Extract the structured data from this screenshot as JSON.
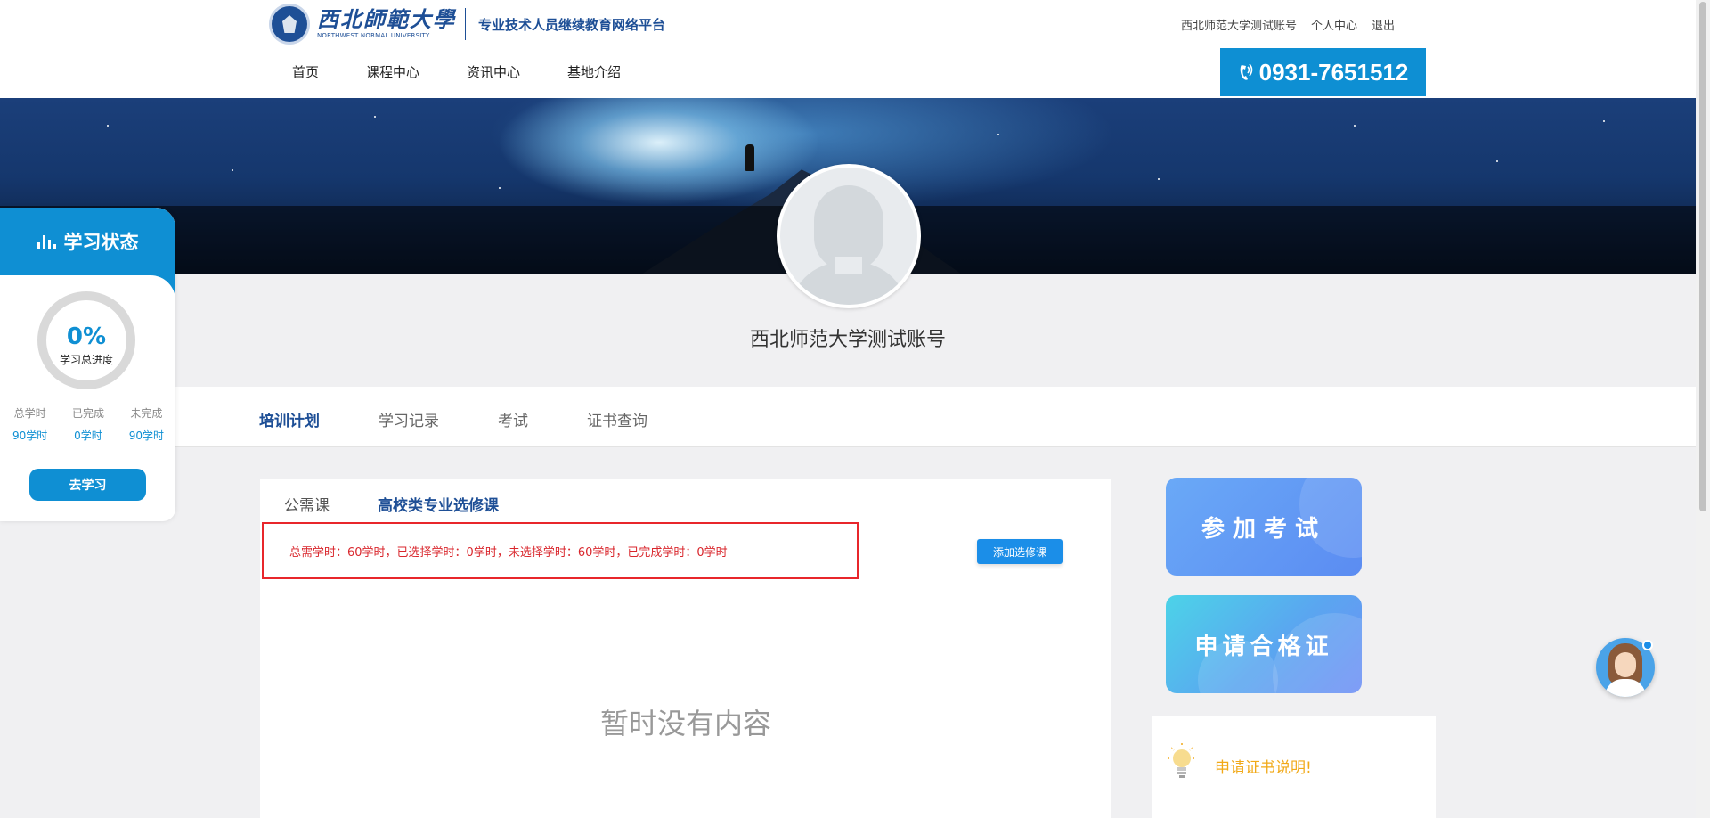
{
  "header": {
    "logo_cn": "西北師範大學",
    "logo_en": "NORTHWEST NORMAL UNIVERSITY",
    "platform_title": "专业技术人员继续教育网络平台",
    "top_links": {
      "account": "西北师范大学测试账号",
      "profile": "个人中心",
      "logout": "退出"
    },
    "nav": [
      "首页",
      "课程中心",
      "资讯中心",
      "基地介绍"
    ],
    "phone": "0931-7651512"
  },
  "profile": {
    "username": "西北师范大学测试账号"
  },
  "tabs": [
    "培训计划",
    "学习记录",
    "考试",
    "证书查询"
  ],
  "active_tab": 0,
  "study_status": {
    "title": "学习状态",
    "progress_percent": "0%",
    "progress_value": 0,
    "progress_label": "学习总进度",
    "stats": [
      {
        "label": "总学时",
        "value": "90学时"
      },
      {
        "label": "已完成",
        "value": "0学时"
      },
      {
        "label": "未完成",
        "value": "90学时"
      }
    ],
    "go_button": "去学习"
  },
  "content": {
    "subtabs": [
      "公需课",
      "高校类专业选修课"
    ],
    "active_subtab": 1,
    "summary": "总需学时：60学时，已选择学时：0学时，未选择学时：60学时，已完成学时：0学时",
    "add_button": "添加选修课",
    "empty_message": "暂时没有内容"
  },
  "side": {
    "exam_label": "参加考试",
    "cert_label": "申请合格证",
    "cert_info": "申请证书说明!"
  },
  "colors": {
    "accent": "#0f8fd3",
    "nav_active": "#1e4f96",
    "alert_red": "#d9262c",
    "info_yellow": "#f1a918"
  }
}
